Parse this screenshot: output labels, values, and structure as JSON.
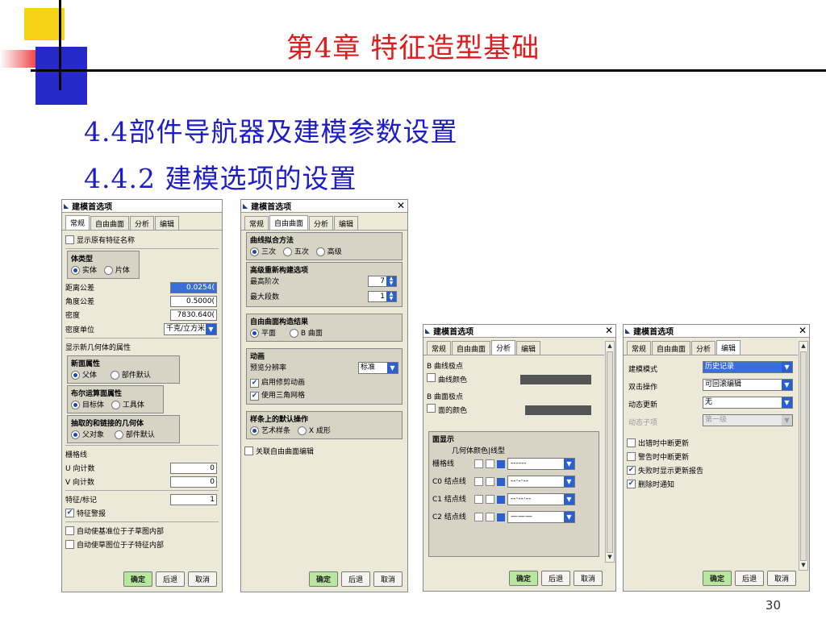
{
  "slide": {
    "title": "第4章 特征造型基础",
    "heading1": "4.4部件导航器及建模参数设置",
    "heading2": "4.4.2 建模选项的设置",
    "page": "30"
  },
  "dialog_title": "建模首选项",
  "tabs": [
    "常规",
    "自由曲面",
    "分析",
    "编辑"
  ],
  "buttons": {
    "ok": "确定",
    "back": "后退",
    "cancel": "取消"
  },
  "d1": {
    "show_orig_name": "显示原有特征名称",
    "body_type_title": "体类型",
    "solid": "实体",
    "sheet": "片体",
    "dist_tol": "距离公差",
    "dist_tol_val": "0.0254(",
    "ang_tol": "角度公差",
    "ang_tol_val": "0.5000(",
    "density": "密度",
    "density_val": "7830.640(",
    "density_unit": "密度单位",
    "density_unit_val": "千克/立方米",
    "new_geom": "显示新几何体的属性",
    "new_face_title": "新面属性",
    "parent": "父体",
    "part_default": "部件默认",
    "bool_title": "布尔运算面属性",
    "target": "目标体",
    "tool": "工具体",
    "extract_title": "抽取的和链接的几何体",
    "parent_obj": "父对象",
    "part_default2": "部件默认",
    "grid": "栅格线",
    "u_count": "U 向计数",
    "u_val": "0",
    "v_count": "V 向计数",
    "v_val": "0",
    "feat_mark": "特征/标记",
    "feat_mark_val": "1",
    "feat_warn": "特征警报",
    "auto_datum": "自动使基准位于子草图内部",
    "auto_sketch": "自动使草图位于子特征内部"
  },
  "d2": {
    "curve_fit_title": "曲线拟合方法",
    "cubic": "三次",
    "quintic": "五次",
    "advanced": "高级",
    "rebuild_title": "高级重新构建选项",
    "max_degree": "最高阶次",
    "max_degree_val": "7",
    "max_seg": "最大段数",
    "max_seg_val": "1",
    "freeform_title": "自由曲面构造结果",
    "plane": "平面",
    "bsurf": "B 曲面",
    "anim_title": "动画",
    "preview_res": "预览分辨率",
    "preview_res_val": "标准",
    "enable_anim": "启用修剪动画",
    "use_tri": "使用三角网格",
    "spline_title": "样条上的默认操作",
    "art_spline": "艺术样条",
    "x_form": "X 成形",
    "assoc_edit": "关联自由曲面编辑"
  },
  "d3": {
    "b_curve_poles": "B 曲线极点",
    "curve_color": "曲线颜色",
    "b_surf_poles": "B 曲面极点",
    "face_color": "面的颜色",
    "face_display": "面显示",
    "geo_color_linetype": "几何体颜色|线型",
    "grid_lines": "栅格线",
    "c0": "C0 结点线",
    "c1": "C1 结点线",
    "c2": "C2 结点线",
    "line_styles": [
      "------",
      "--·-·--",
      "--·--·--",
      "———"
    ]
  },
  "d4": {
    "modeling_mode": "建模模式",
    "modeling_mode_val": "历史记录",
    "double_click": "双击操作",
    "double_click_val": "可回滚编辑",
    "dyn_update": "动态更新",
    "dyn_update_val": "无",
    "dyn_sub": "动态子项",
    "dyn_sub_val": "第一级",
    "err_update": "出错时中断更新",
    "warn_update": "警告时中断更新",
    "fail_report": "失败时显示更新报告",
    "del_notify": "删除时通知"
  }
}
